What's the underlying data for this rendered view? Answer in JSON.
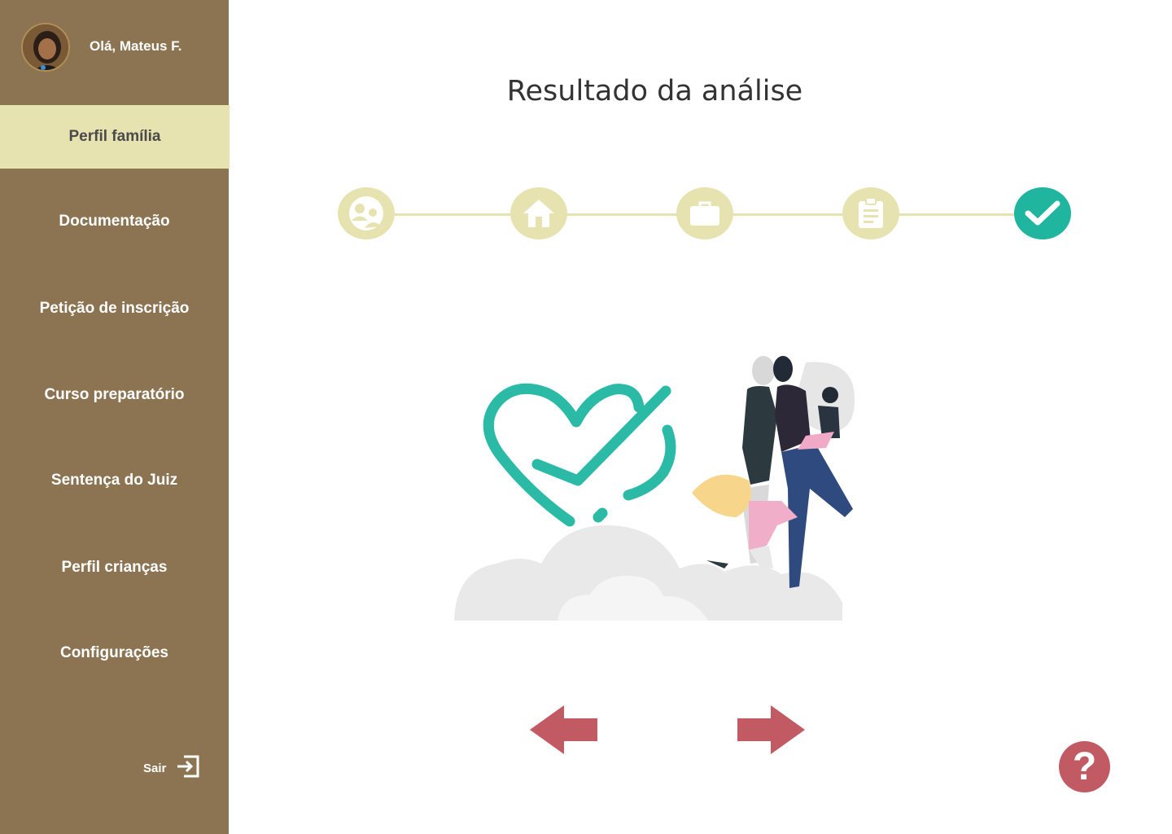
{
  "user": {
    "greeting": "Olá, Mateus F."
  },
  "nav": {
    "items": [
      {
        "label": "Perfil família",
        "active": true
      },
      {
        "label": "Documentação"
      },
      {
        "label": "Petição de inscrição"
      },
      {
        "label": "Curso preparatório"
      },
      {
        "label": "Sentença do Juiz"
      },
      {
        "label": "Perfil crianças"
      },
      {
        "label": "Configurações"
      }
    ],
    "logout_label": "Sair"
  },
  "main": {
    "title": "Resultado da análise",
    "steps": [
      {
        "icon": "family-icon",
        "state": "pending"
      },
      {
        "icon": "home-icon",
        "state": "pending"
      },
      {
        "icon": "briefcase-icon",
        "state": "pending"
      },
      {
        "icon": "clipboard-icon",
        "state": "pending"
      },
      {
        "icon": "check-icon",
        "state": "done"
      }
    ]
  },
  "help_label": "?",
  "colors": {
    "sidebar": "#8c7452",
    "active": "#e6e3b0",
    "accent": "#1fb59e",
    "arrow": "#c25a64"
  }
}
